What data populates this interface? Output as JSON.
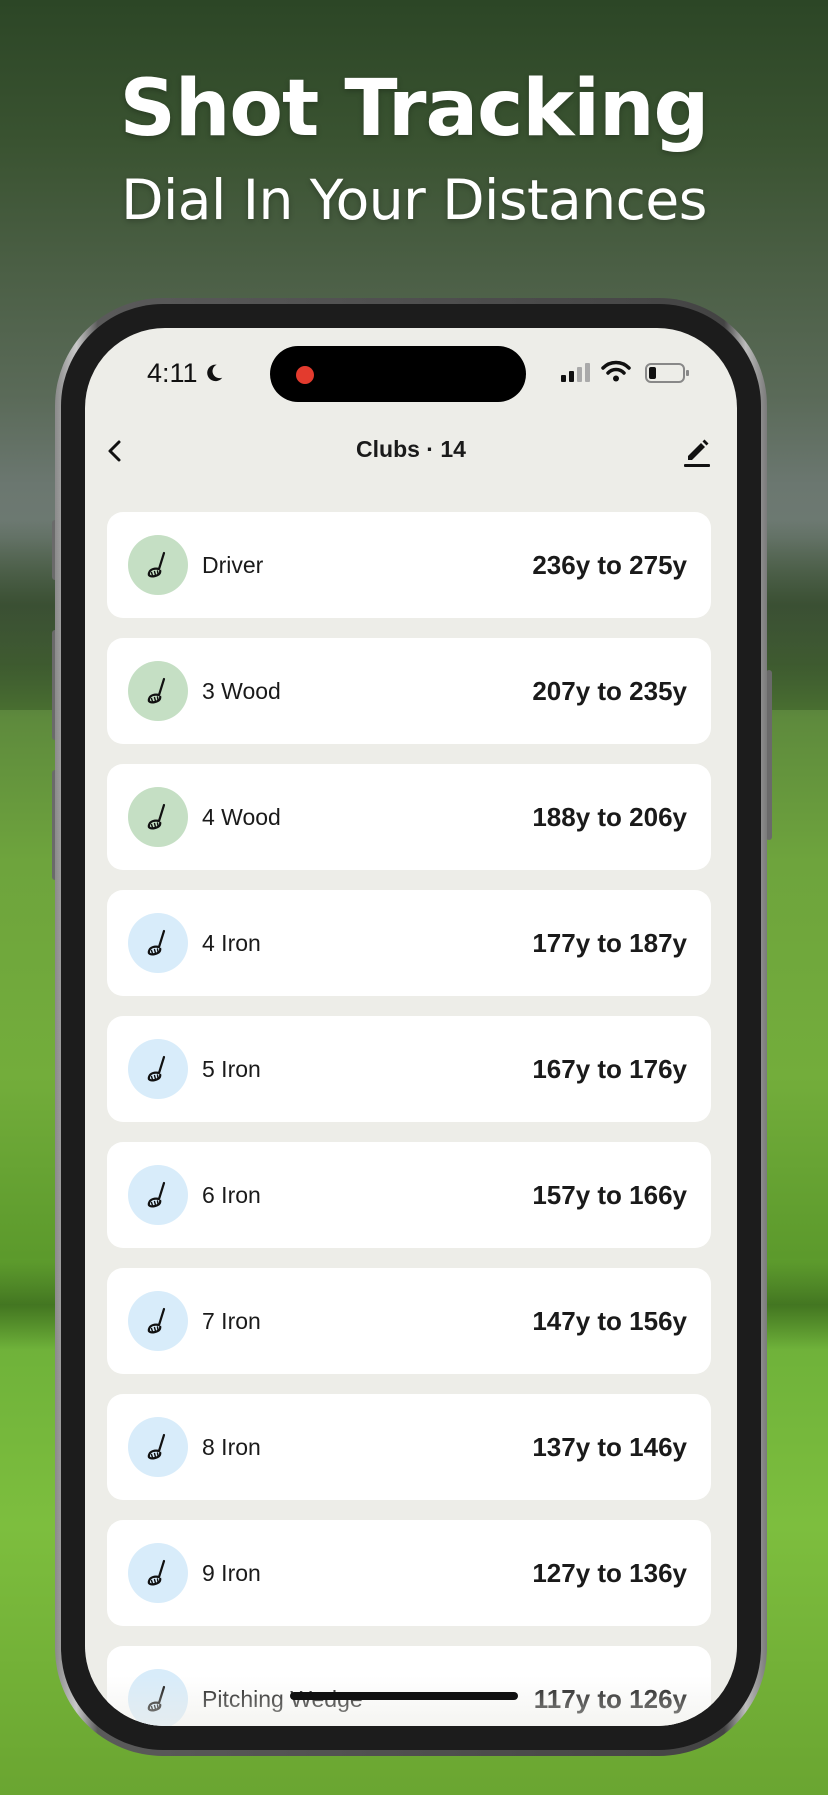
{
  "promo": {
    "title": "Shot Tracking",
    "subtitle": "Dial In Your Distances"
  },
  "status_bar": {
    "time": "4:11",
    "moon_icon": "moon-icon",
    "recording_indicator_color": "#e33b2e"
  },
  "nav": {
    "title": "Clubs · 14",
    "back_icon": "chevron-left-icon",
    "edit_icon": "pencil-icon"
  },
  "clubs": [
    {
      "name": "Driver",
      "range": "236y to 275y",
      "type": "wood"
    },
    {
      "name": "3 Wood",
      "range": "207y to 235y",
      "type": "wood"
    },
    {
      "name": "4 Wood",
      "range": "188y to 206y",
      "type": "wood"
    },
    {
      "name": "4 Iron",
      "range": "177y to 187y",
      "type": "iron"
    },
    {
      "name": "5 Iron",
      "range": "167y to 176y",
      "type": "iron"
    },
    {
      "name": "6 Iron",
      "range": "157y to 166y",
      "type": "iron"
    },
    {
      "name": "7 Iron",
      "range": "147y to 156y",
      "type": "iron"
    },
    {
      "name": "8 Iron",
      "range": "137y to 146y",
      "type": "iron"
    },
    {
      "name": "9 Iron",
      "range": "127y to 136y",
      "type": "iron"
    },
    {
      "name": "Pitching Wedge",
      "range": "117y to 126y",
      "type": "iron"
    }
  ],
  "colors": {
    "wood_icon_bg": "#c5dfc4",
    "iron_icon_bg": "#d8ecfa",
    "screen_bg": "#edede8",
    "card_bg": "#ffffff"
  }
}
